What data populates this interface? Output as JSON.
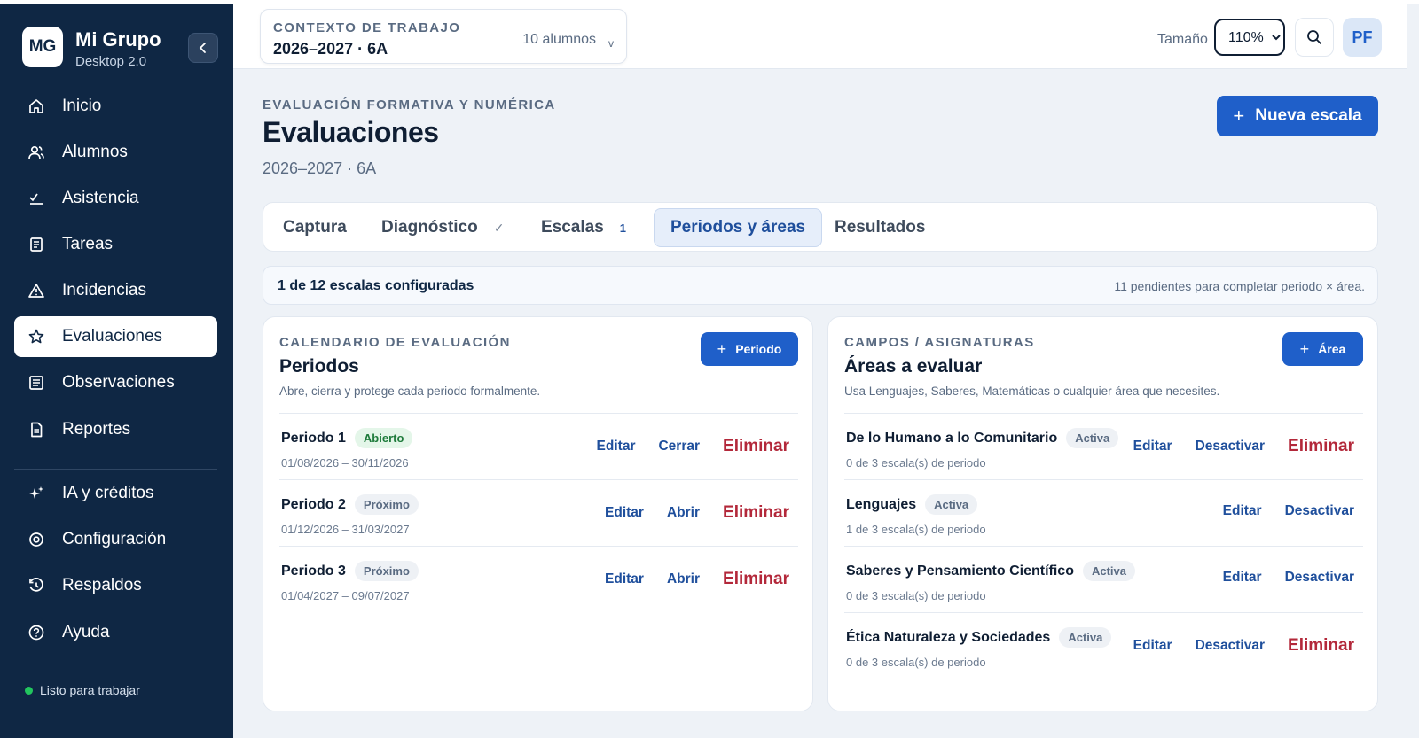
{
  "sidebar": {
    "brand_initials": "MG",
    "brand_title": "Mi Grupo",
    "brand_subtitle": "Desktop 2.0",
    "items": [
      {
        "label": "Inicio",
        "icon": "home-icon"
      },
      {
        "label": "Alumnos",
        "icon": "users-icon"
      },
      {
        "label": "Asistencia",
        "icon": "checklist-icon"
      },
      {
        "label": "Tareas",
        "icon": "document-icon"
      },
      {
        "label": "Incidencias",
        "icon": "warning-icon"
      },
      {
        "label": "Evaluaciones",
        "icon": "star-icon",
        "active": true
      },
      {
        "label": "Observaciones",
        "icon": "notes-icon"
      },
      {
        "label": "Reportes",
        "icon": "report-icon"
      },
      {
        "label": "IA y créditos",
        "icon": "sparkles-icon"
      },
      {
        "label": "Configuración",
        "icon": "gear-icon"
      },
      {
        "label": "Respaldos",
        "icon": "history-icon"
      },
      {
        "label": "Ayuda",
        "icon": "help-icon"
      }
    ],
    "status_text": "Listo para trabajar"
  },
  "header": {
    "context_label": "CONTEXTO DE TRABAJO",
    "context_value": "2026–2027 · 6A",
    "context_count": "10 alumnos",
    "size_label": "Tamaño",
    "size_value": "110%",
    "avatar_initials": "PF"
  },
  "page": {
    "eyebrow": "EVALUACIÓN FORMATIVA Y NUMÉRICA",
    "title": "Evaluaciones",
    "subtitle": "2026–2027 · 6A",
    "primary_button": "Nueva escala"
  },
  "tabs": [
    {
      "label": "Captura"
    },
    {
      "label": "Diagnóstico",
      "check": "✓"
    },
    {
      "label": "Escalas",
      "badge": "1"
    },
    {
      "label": "Periodos y áreas",
      "active": true
    },
    {
      "label": "Resultados"
    }
  ],
  "summary": {
    "left": "1 de 12 escalas configuradas",
    "right": "11 pendientes para completar periodo × área."
  },
  "periods_panel": {
    "eyebrow": "CALENDARIO DE EVALUACIÓN",
    "title": "Periodos",
    "subtitle": "Abre, cierra y protege cada periodo formalmente.",
    "button": "Periodo",
    "rows": [
      {
        "name": "Periodo 1",
        "status": "Abierto",
        "dates": "01/08/2026 – 30/11/2026",
        "actions": [
          "Editar",
          "Cerrar",
          "Eliminar"
        ]
      },
      {
        "name": "Periodo 2",
        "status": "Próximo",
        "dates": "01/12/2026 – 31/03/2027",
        "actions": [
          "Editar",
          "Abrir",
          "Eliminar"
        ]
      },
      {
        "name": "Periodo 3",
        "status": "Próximo",
        "dates": "01/04/2027 – 09/07/2027",
        "actions": [
          "Editar",
          "Abrir",
          "Eliminar"
        ]
      }
    ]
  },
  "areas_panel": {
    "eyebrow": "CAMPOS / ASIGNATURAS",
    "title": "Áreas a evaluar",
    "subtitle": "Usa Lenguajes, Saberes, Matemáticas o cualquier área que necesites.",
    "button": "Área",
    "rows": [
      {
        "name": "De lo Humano a lo Comunitario",
        "status": "Activa",
        "meta": "0 de 3 escala(s) de periodo",
        "actions": [
          "Editar",
          "Desactivar",
          "Eliminar"
        ]
      },
      {
        "name": "Lenguajes",
        "status": "Activa",
        "meta": "1 de 3 escala(s) de periodo",
        "actions": [
          "Editar",
          "Desactivar"
        ]
      },
      {
        "name": "Saberes y Pensamiento Científico",
        "status": "Activa",
        "meta": "0 de 3 escala(s) de periodo",
        "actions": [
          "Editar",
          "Desactivar"
        ]
      },
      {
        "name": "Ética Naturaleza y Sociedades",
        "status": "Activa",
        "meta": "0 de 3 escala(s) de periodo",
        "actions": [
          "Editar",
          "Desactivar",
          "Eliminar"
        ]
      }
    ]
  },
  "colors": {
    "sidebar_bg": "#0f2744",
    "primary": "#1f5fc9",
    "danger": "#b3283a",
    "open_badge": "#1e7b3b"
  }
}
